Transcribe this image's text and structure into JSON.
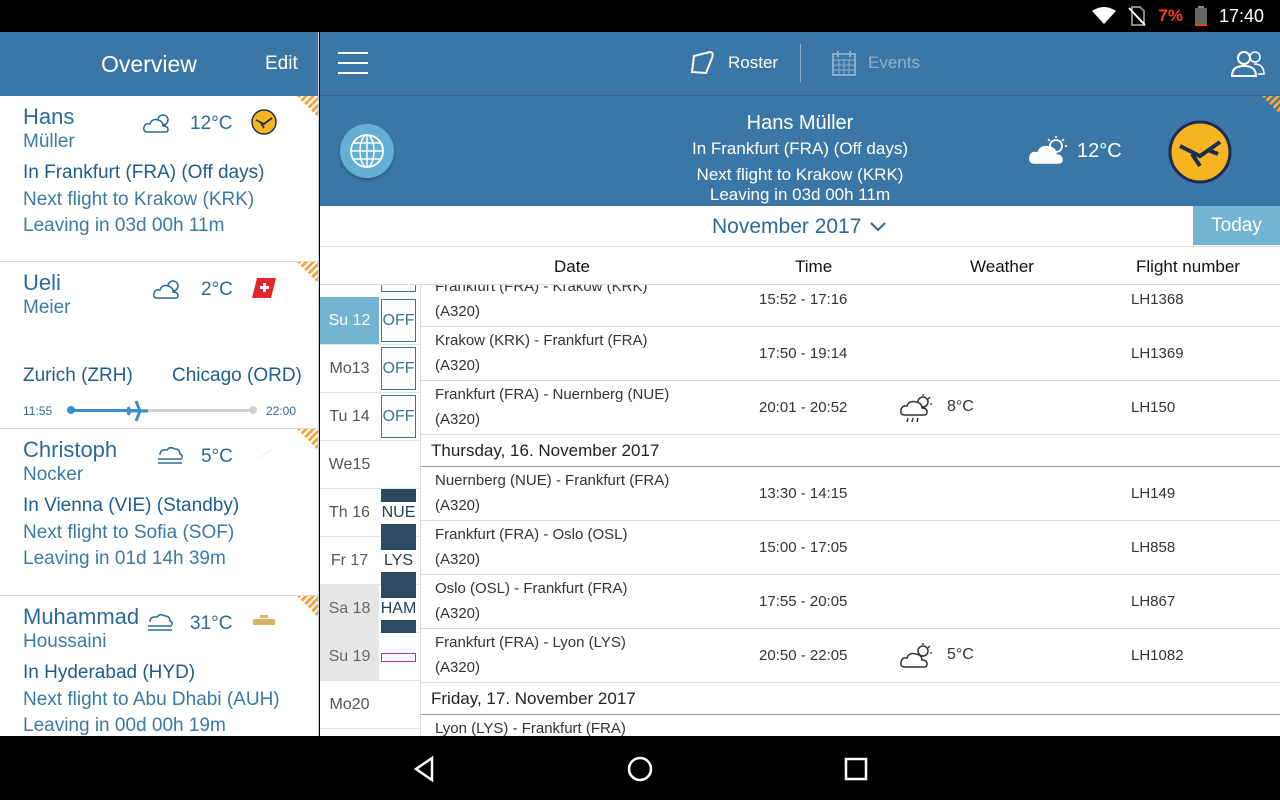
{
  "status": {
    "battery_pct": "7%",
    "time": "17:40"
  },
  "sidebar": {
    "title": "Overview",
    "edit_label": "Edit",
    "cards": [
      {
        "first": "Hans",
        "last": "Müller",
        "temp": "12°C",
        "location": "In Frankfurt (FRA) (Off days)",
        "next": "Next flight to Krakow (KRK)",
        "leaving": "Leaving in 03d 00h 11m",
        "weather_icon": "partly-cloudy-icon",
        "airline_icon": "lufthansa-logo-icon"
      },
      {
        "first": "Ueli",
        "last": "Meier",
        "temp": "2°C",
        "from": "Zurich (ZRH)",
        "to": "Chicago (ORD)",
        "dep_time": "11:55",
        "arr_time": "22:00",
        "progress": 0.37,
        "weather_icon": "partly-cloudy-icon",
        "airline_icon": "swiss-logo-icon"
      },
      {
        "first": "Christoph",
        "last": "Nocker",
        "temp": "5°C",
        "location": "In Vienna (VIE) (Standby)",
        "next": "Next flight to Sofia (SOF)",
        "leaving": "Leaving in 01d 14h 39m",
        "weather_icon": "fog-icon",
        "airline_icon": "austrian-logo-icon"
      },
      {
        "first": "Muhammad",
        "last": "Houssaini",
        "temp": "31°C",
        "location": "In Hyderabad (HYD)",
        "next": "Next flight to Abu Dhabi (AUH)",
        "leaving": "Leaving in 00d 00h 19m",
        "weather_icon": "fog-icon",
        "airline_icon": "etihad-logo-icon"
      }
    ]
  },
  "topbar": {
    "roster_label": "Roster",
    "events_label": "Events"
  },
  "profile": {
    "name": "Hans Müller",
    "location": "In Frankfurt (FRA) (Off days)",
    "next": "Next flight to Krakow (KRK)",
    "leaving": "Leaving in 03d 00h 11m",
    "temp": "12°C"
  },
  "calendar_header": {
    "month": "November 2017",
    "today_label": "Today"
  },
  "columns": {
    "date": "Date",
    "time": "Time",
    "weather": "Weather",
    "flight_number": "Flight number"
  },
  "days": [
    {
      "label": "Su 12",
      "box": "OFF",
      "style": "sel",
      "box_type": "off"
    },
    {
      "label": "Mo13",
      "box": "OFF",
      "style": "",
      "box_type": "off"
    },
    {
      "label": "Tu 14",
      "box": "OFF",
      "style": "",
      "box_type": "off"
    },
    {
      "label": "We15",
      "box": "",
      "style": "",
      "box_type": "none"
    },
    {
      "label": "Th 16",
      "box": "NUE",
      "style": "",
      "box_type": "dest"
    },
    {
      "label": "Fr  17",
      "box": "LYS",
      "style": "",
      "box_type": "dest"
    },
    {
      "label": "Sa 18",
      "box": "HAM",
      "style": "wkend",
      "box_type": "dest"
    },
    {
      "label": "Su 19",
      "box": "",
      "style": "wkend",
      "box_type": "pending"
    },
    {
      "label": "Mo20",
      "box": "",
      "style": "",
      "box_type": "none"
    }
  ],
  "flights": [
    {
      "route": "Frankfurt (FRA) - Krakow (KRK)",
      "aircraft": "(A320)",
      "time": "15:52 - 17:16",
      "weather": "",
      "fn": "LH1368"
    },
    {
      "route": "Krakow (KRK) - Frankfurt (FRA)",
      "aircraft": "(A320)",
      "time": "17:50 - 19:14",
      "weather": "",
      "fn": "LH1369"
    },
    {
      "route": "Frankfurt (FRA) - Nuernberg (NUE)",
      "aircraft": "(A320)",
      "time": "20:01 - 20:52",
      "weather": "8°C",
      "fn": "LH150"
    },
    {
      "day_header": "Thursday, 16. November 2017"
    },
    {
      "route": "Nuernberg (NUE) - Frankfurt (FRA)",
      "aircraft": "(A320)",
      "time": "13:30 - 14:15",
      "weather": "",
      "fn": "LH149"
    },
    {
      "route": "Frankfurt (FRA) - Oslo (OSL)",
      "aircraft": "(A320)",
      "time": "15:00 - 17:05",
      "weather": "",
      "fn": "LH858"
    },
    {
      "route": "Oslo (OSL) - Frankfurt (FRA)",
      "aircraft": "(A320)",
      "time": "17:55 - 20:05",
      "weather": "",
      "fn": "LH867"
    },
    {
      "route": "Frankfurt (FRA) - Lyon (LYS)",
      "aircraft": "(A320)",
      "time": "20:50 - 22:05",
      "weather": "5°C",
      "fn": "LH1082"
    },
    {
      "day_header": "Friday, 17. November 2017"
    },
    {
      "route": "Lyon (LYS) - Frankfurt (FRA)",
      "aircraft": "",
      "time": "",
      "weather": "",
      "fn": ""
    }
  ],
  "colors": {
    "primary": "#3a77a6",
    "accent": "#73b4d3",
    "lufthansa_yellow": "#f9b520",
    "swiss_red": "#e3262b"
  }
}
